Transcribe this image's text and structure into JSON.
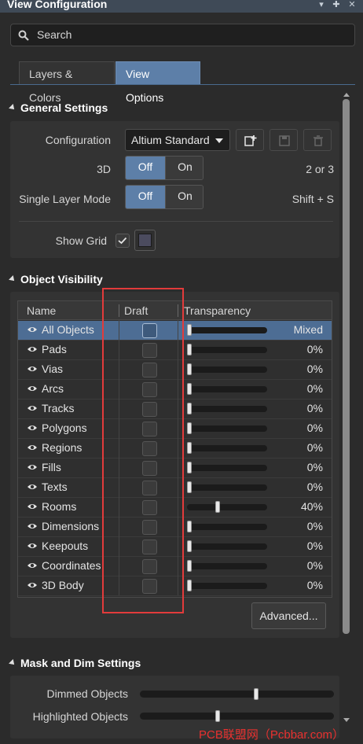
{
  "window": {
    "title": "View Configuration"
  },
  "search": {
    "placeholder": "Search"
  },
  "tabs": [
    {
      "label": "Layers & Colors",
      "active": false
    },
    {
      "label": "View Options",
      "active": true
    }
  ],
  "general_settings": {
    "header": "General Settings",
    "configuration": {
      "label": "Configuration",
      "value": "Altium Standard"
    },
    "three_d": {
      "label": "3D",
      "off": "Off",
      "on": "On",
      "hint": "2 or 3",
      "selected": "Off"
    },
    "single_layer": {
      "label": "Single Layer Mode",
      "off": "Off",
      "on": "On",
      "hint": "Shift + S",
      "selected": "Off"
    },
    "show_grid": {
      "label": "Show Grid",
      "checked": true,
      "color": "#4b4b5e"
    }
  },
  "object_visibility": {
    "header": "Object Visibility",
    "columns": {
      "name": "Name",
      "draft": "Draft",
      "transparency": "Transparency"
    },
    "rows": [
      {
        "name": "All Objects",
        "value": "Mixed",
        "level": 0,
        "selected": true
      },
      {
        "name": "Pads",
        "value": "0%",
        "level": 0
      },
      {
        "name": "Vias",
        "value": "0%",
        "level": 0
      },
      {
        "name": "Arcs",
        "value": "0%",
        "level": 0
      },
      {
        "name": "Tracks",
        "value": "0%",
        "level": 0
      },
      {
        "name": "Polygons",
        "value": "0%",
        "level": 0
      },
      {
        "name": "Regions",
        "value": "0%",
        "level": 0
      },
      {
        "name": "Fills",
        "value": "0%",
        "level": 0
      },
      {
        "name": "Texts",
        "value": "0%",
        "level": 0
      },
      {
        "name": "Rooms",
        "value": "40%",
        "level": 0.4
      },
      {
        "name": "Dimensions",
        "value": "0%",
        "level": 0
      },
      {
        "name": "Keepouts",
        "value": "0%",
        "level": 0
      },
      {
        "name": "Coordinates",
        "value": "0%",
        "level": 0
      },
      {
        "name": "3D Body",
        "value": "0%",
        "level": 0
      }
    ],
    "advanced_label": "Advanced..."
  },
  "mask_dim": {
    "header": "Mask and Dim Settings",
    "dimmed": {
      "label": "Dimmed Objects",
      "level": 0.6
    },
    "highlighted": {
      "label": "Highlighted Objects",
      "level": 0.4
    }
  },
  "watermark": "PCB联盟网（Pcbbar.com）",
  "colors": {
    "accent": "#5d7fa8",
    "selection": "#4d6d94",
    "annotation": "#e23b3b"
  }
}
